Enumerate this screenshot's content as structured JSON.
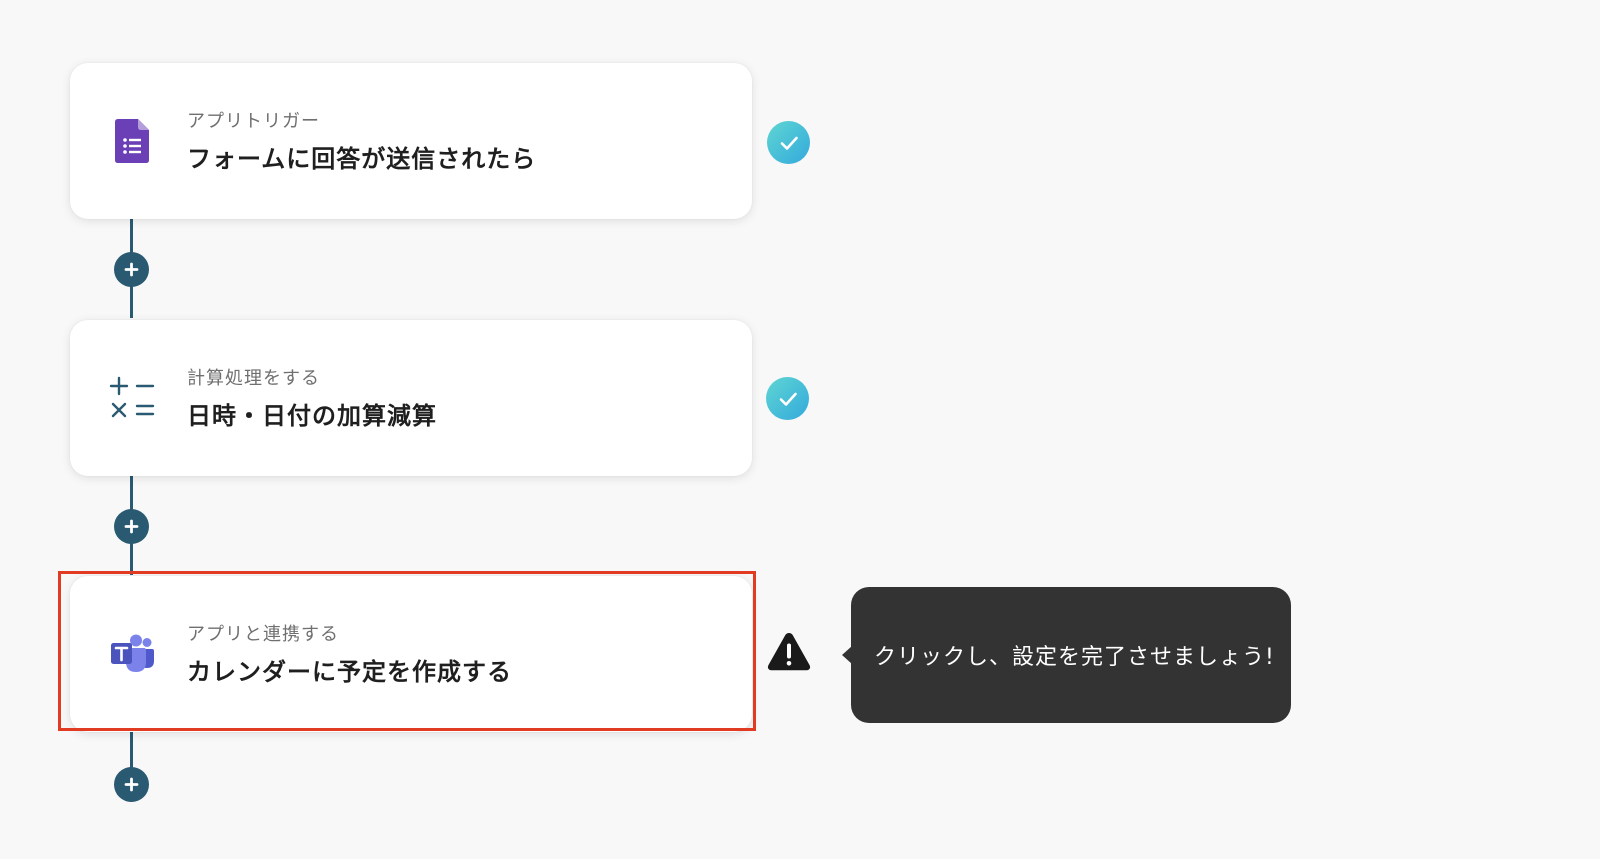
{
  "flow": {
    "steps": [
      {
        "category": "アプリトリガー",
        "title": "フォームに回答が送信されたら",
        "icon": "google-forms-icon",
        "status": "completed",
        "icon_color": "#6b3fb6"
      },
      {
        "category": "計算処理をする",
        "title": "日時・日付の加算減算",
        "icon": "calculator-operators-icon",
        "status": "completed",
        "icon_color": "#2a5a72"
      },
      {
        "category": "アプリと連携する",
        "title": "カレンダーに予定を作成する",
        "icon": "microsoft-teams-icon",
        "status": "warning",
        "icon_color": "#5059c9",
        "highlighted": true
      }
    ]
  },
  "tooltip": {
    "text": "クリックし、設定を完了させましょう!"
  },
  "colors": {
    "connector": "#2a5a72",
    "highlight_border": "#e23b24",
    "check_gradient_start": "#5fd6d2",
    "check_gradient_end": "#33a9dd",
    "tooltip_bg": "#333333",
    "warning": "#1a1a1a"
  }
}
